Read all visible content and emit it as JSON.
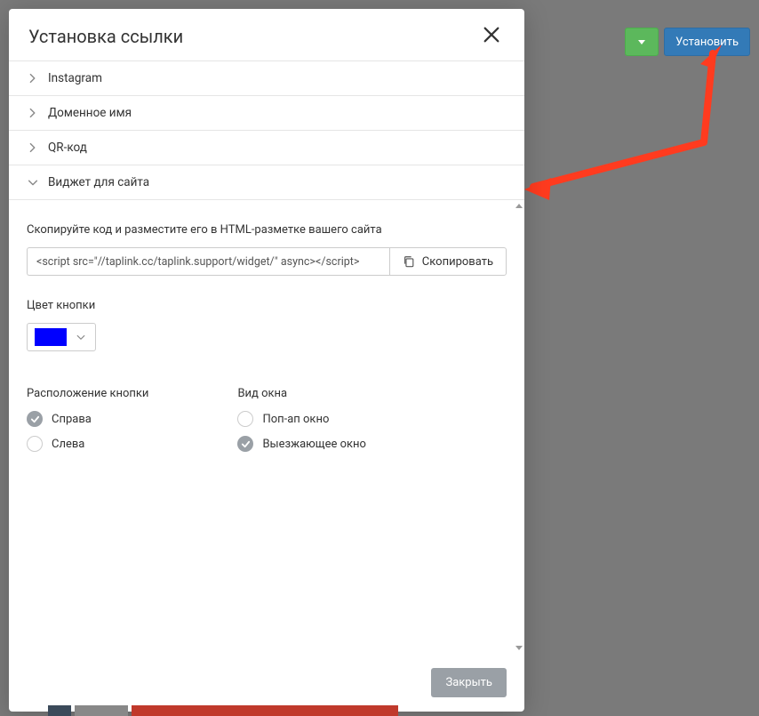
{
  "header": {
    "install_label": "Установить"
  },
  "modal": {
    "title": "Установка ссылки",
    "close_title": "Close"
  },
  "accordion": {
    "instagram": "Instagram",
    "domain": "Доменное имя",
    "qr": "QR-код",
    "widget": "Виджет для сайта"
  },
  "widget": {
    "copy_instruction": "Скопируйте код и разместите его в HTML-разметке вашего сайта",
    "code_value": "<script src=\"//taplink.cc/taplink.support/widget/\" async></script>",
    "copy_label": "Скопировать",
    "color_label": "Цвет кнопки",
    "color_value": "#0000ff",
    "position_label": "Расположение кнопки",
    "position_options": {
      "right": "Справа",
      "left": "Слева"
    },
    "window_label": "Вид окна",
    "window_options": {
      "popup": "Поп-ап окно",
      "slideout": "Выезжающее окно"
    }
  },
  "footer": {
    "close_label": "Закрыть"
  }
}
